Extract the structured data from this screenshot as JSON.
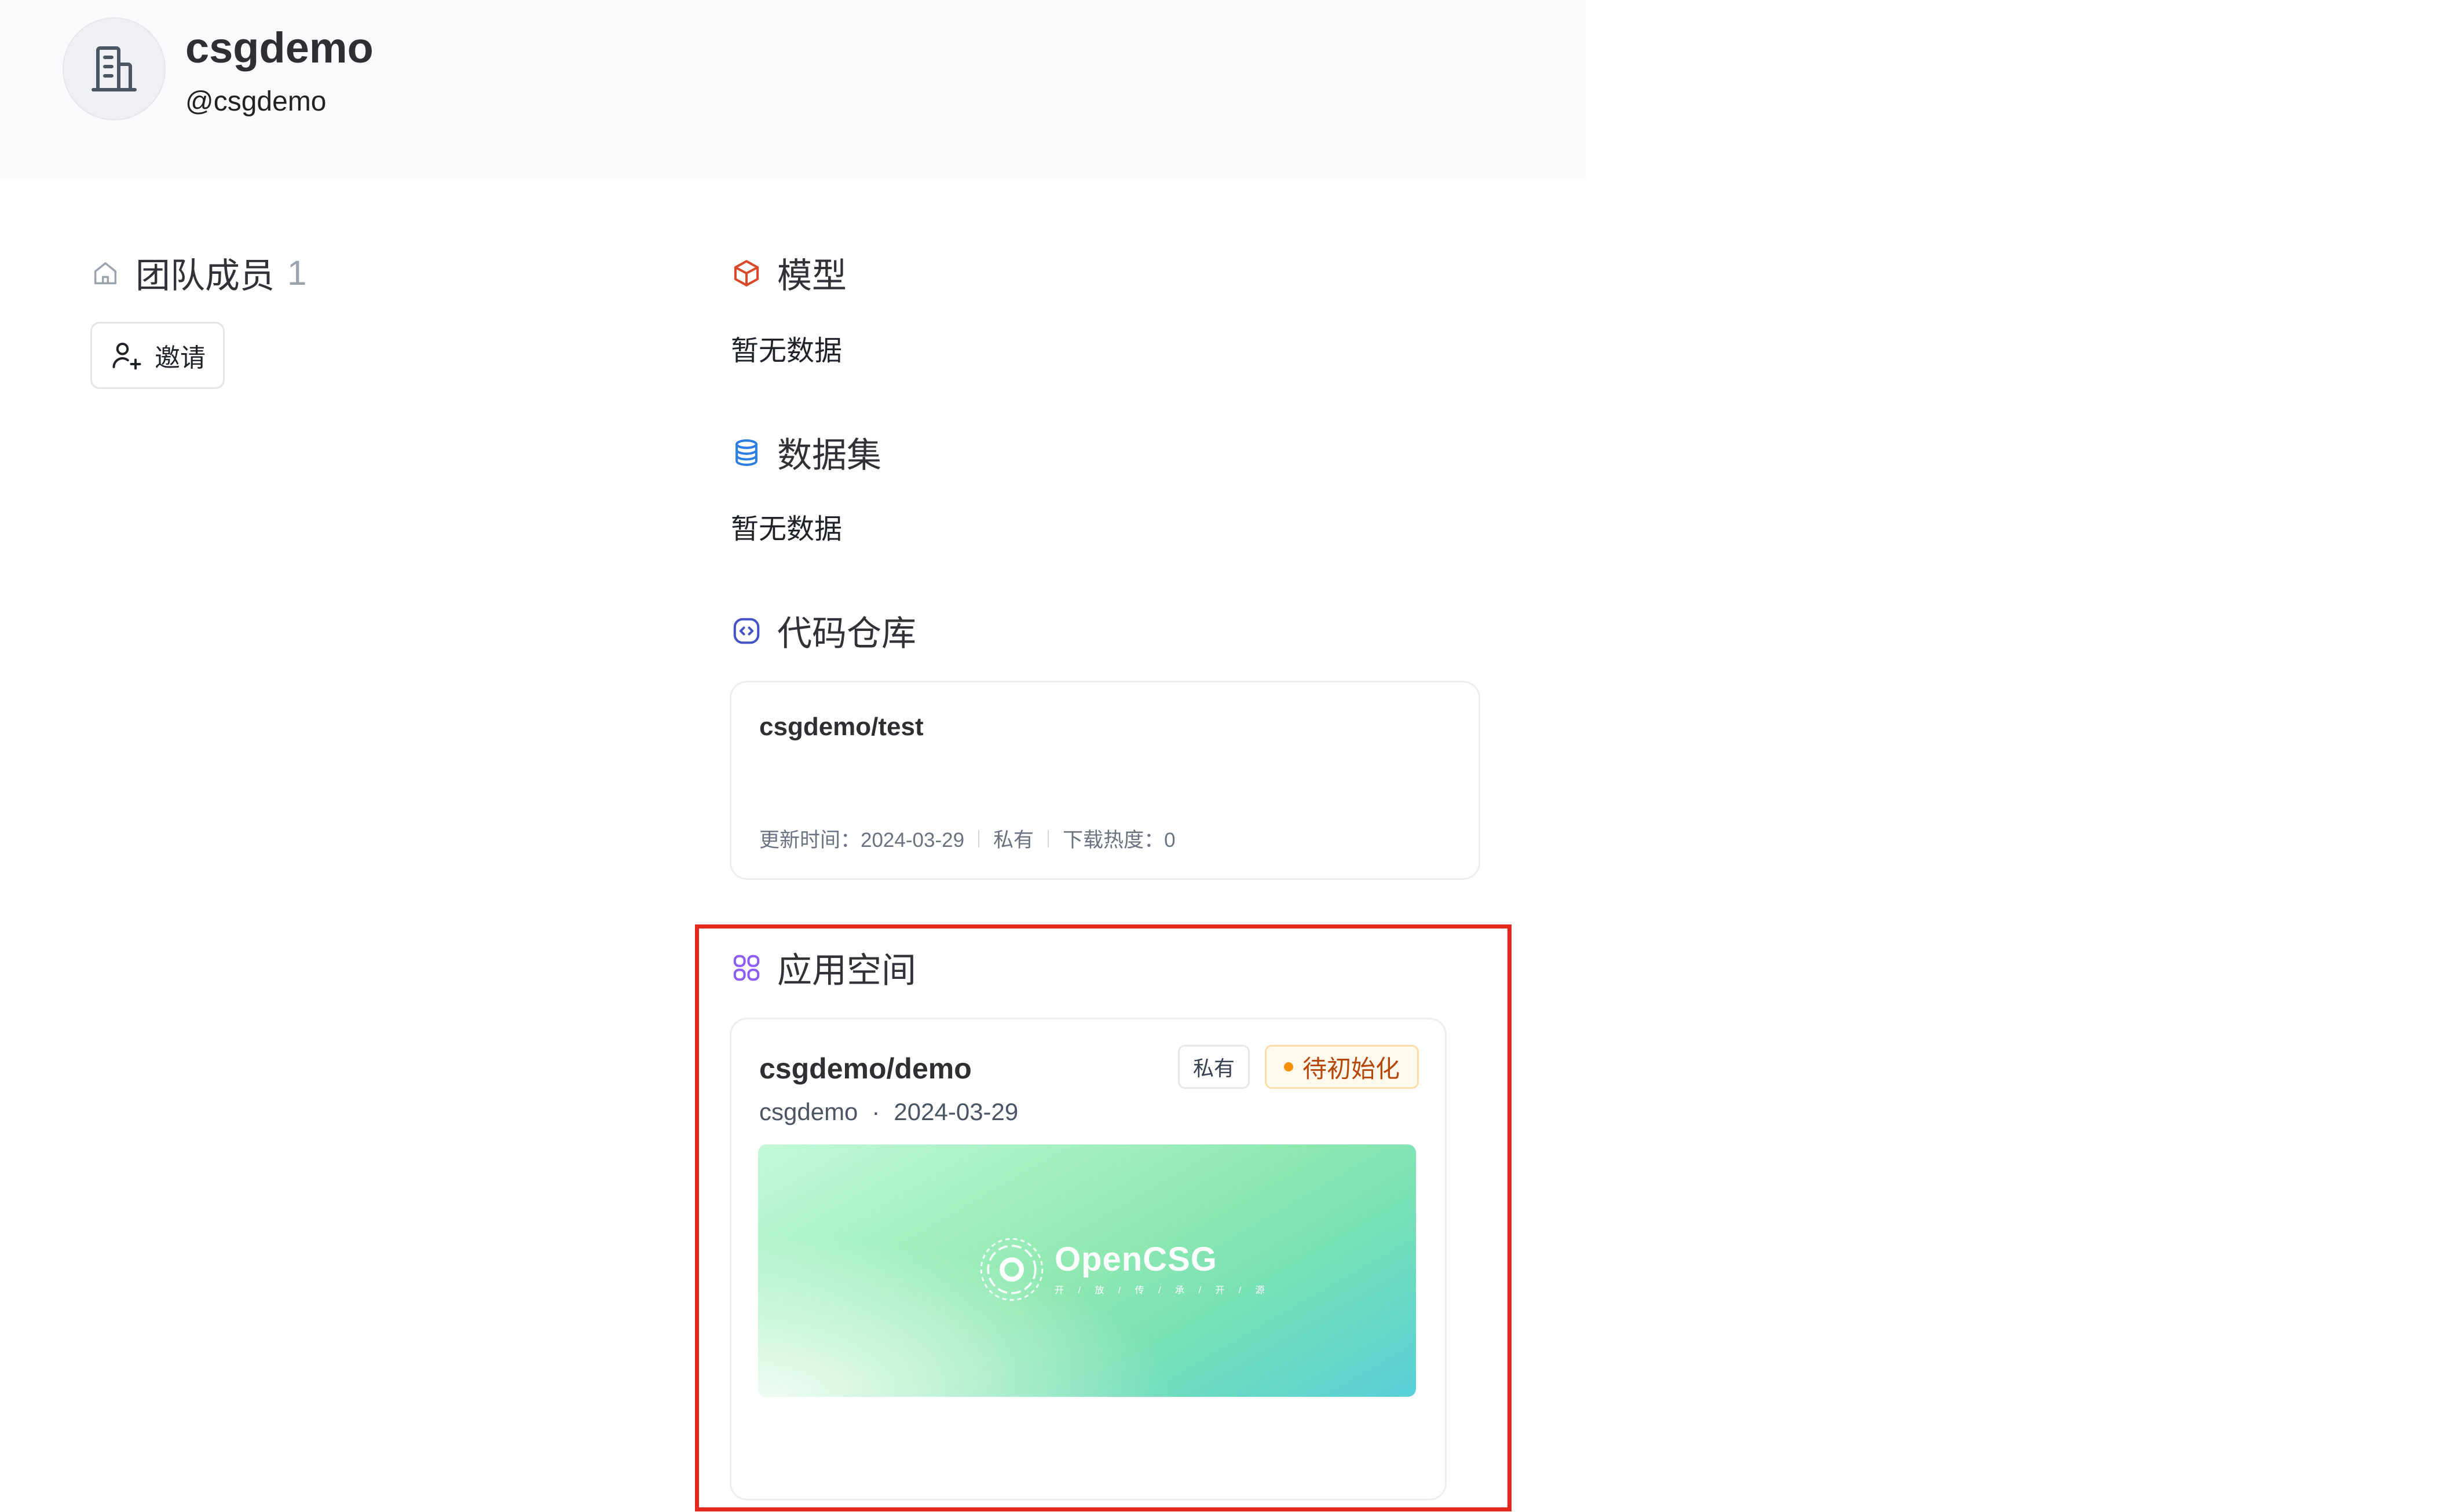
{
  "org": {
    "name": "csgdemo",
    "handle": "@csgdemo"
  },
  "members": {
    "title": "团队成员",
    "count": "1",
    "invite_label": "邀请"
  },
  "models": {
    "title": "模型",
    "empty": "暂无数据"
  },
  "datasets": {
    "title": "数据集",
    "empty": "暂无数据"
  },
  "code_repos": {
    "title": "代码仓库",
    "items": [
      {
        "name": "csgdemo/test",
        "updated_label": "更新时间：2024-03-29",
        "visibility": "私有",
        "downloads_label": "下载热度：0"
      }
    ]
  },
  "spaces": {
    "title": "应用空间",
    "items": [
      {
        "name": "csgdemo/demo",
        "visibility": "私有",
        "status": "待初始化",
        "owner": "csgdemo",
        "separator": "·",
        "date": "2024-03-29",
        "cover_logo": "OpenCSG",
        "cover_tagline": "开 / 放 / 传 / 承 / 开 / 源"
      }
    ]
  },
  "colors": {
    "model_icon": "#d9482b",
    "dataset_icon": "#2e7de0",
    "code_icon": "#4454c7",
    "space_icon": "#8b5cf6",
    "status_dot": "#f79009",
    "highlight": "#e5281e"
  },
  "icons": {
    "avatar": "building-icon",
    "members": "home-icon",
    "invite": "user-plus-icon",
    "models": "cube-icon",
    "datasets": "database-icon",
    "code": "code-icon",
    "spaces": "grid-icon"
  }
}
